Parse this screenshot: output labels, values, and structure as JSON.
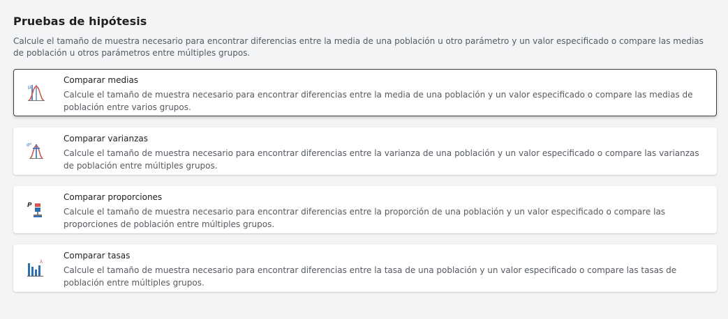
{
  "section": {
    "title": "Pruebas de hipótesis",
    "description": "Calcule el tamaño de muestra necesario para encontrar diferencias entre la media de una población u otro parámetro y un valor especificado o compare las medias de población u otros parámetros entre múltiples grupos."
  },
  "cards": [
    {
      "title": "Comparar medias",
      "description": "Calcule el tamaño de muestra necesario para encontrar diferencias entre la media de una población y un valor especificado o compare las medias de población entre varios grupos.",
      "icon": "compare-means-icon",
      "selected": true
    },
    {
      "title": "Comparar varianzas",
      "description": "Calcule el tamaño de muestra necesario para encontrar diferencias entre la varianza de una población y un valor especificado o compare las varianzas de población entre múltiples grupos.",
      "icon": "compare-variances-icon",
      "selected": false
    },
    {
      "title": "Comparar proporciones",
      "description": "Calcule el tamaño de muestra necesario para encontrar diferencias entre la proporción de una población y un valor especificado o compare las proporciones de población entre múltiples grupos.",
      "icon": "compare-proportions-icon",
      "selected": false
    },
    {
      "title": "Comparar tasas",
      "description": "Calcule el tamaño de muestra necesario para encontrar diferencias entre la tasa de una población y un valor especificado o compare las tasas de población entre múltiples grupos.",
      "icon": "compare-rates-icon",
      "selected": false
    }
  ],
  "colors": {
    "background": "#f3f4f6",
    "card": "#ffffff",
    "selected_border": "#3d3d3d",
    "icon_blue": "#2e6fb3",
    "icon_red": "#d9534f"
  }
}
